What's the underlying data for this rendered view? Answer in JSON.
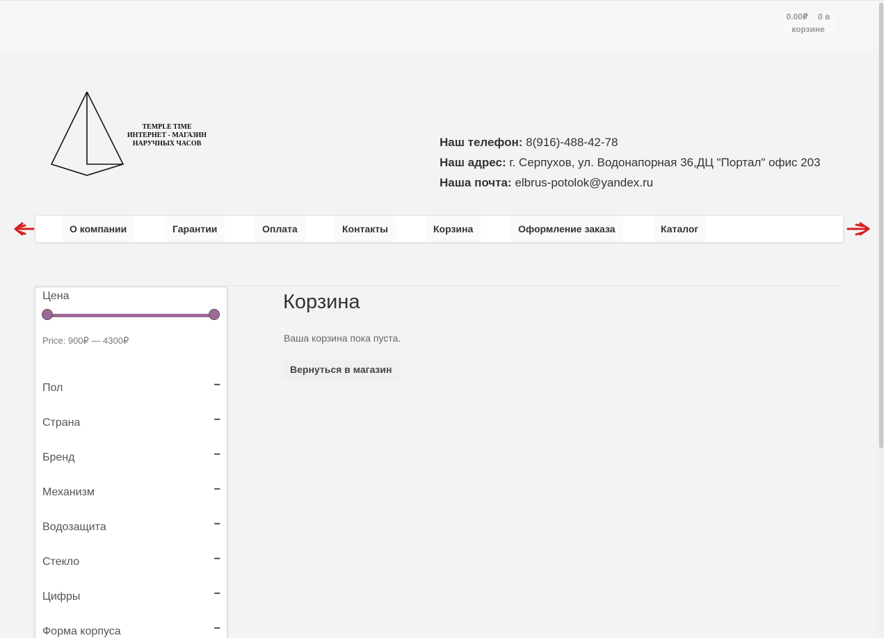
{
  "header": {
    "cart_total": "0.00₽",
    "cart_count": "0 в",
    "cart_word": "корзине",
    "logo_lines": [
      "TEMPLE TIME",
      "ИНТЕРНЕТ - МАГАЗИН",
      "НАРУЧНЫХ ЧАСОВ"
    ]
  },
  "contacts": {
    "phone_label": "Наш телефон:",
    "phone_value": "8(916)-488-42-78",
    "address_label": "Наш адрес:",
    "address_value": "г. Серпухов, ул. Водонапорная 36,ДЦ \"Портал\" офис 203",
    "email_label": "Наша почта:",
    "email_value": "elbrus-potolok@yandex.ru"
  },
  "nav": {
    "items": [
      "О компании",
      "Гарантии",
      "Оплата",
      "Контакты",
      "Корзина",
      "Оформление заказа",
      "Каталог"
    ],
    "prev_icon": "arrow-left-icon",
    "next_icon": "arrow-right-icon"
  },
  "sidebar": {
    "price_title": "Цена",
    "price_range": "Price: 900₽ — 4300₽",
    "price_min": 900,
    "price_max": 4300,
    "filters": [
      "Пол",
      "Страна",
      "Бренд",
      "Механизм",
      "Водозащита",
      "Стекло",
      "Цифры",
      "Форма корпуса"
    ],
    "collapse_symbol": "−"
  },
  "main": {
    "title": "Корзина",
    "empty_message": "Ваша корзина пока пуста.",
    "return_button": "Вернуться в магазин"
  },
  "colors": {
    "slider": "#a0689a",
    "arrows": "#d42020",
    "background": "#f3f3f4"
  }
}
